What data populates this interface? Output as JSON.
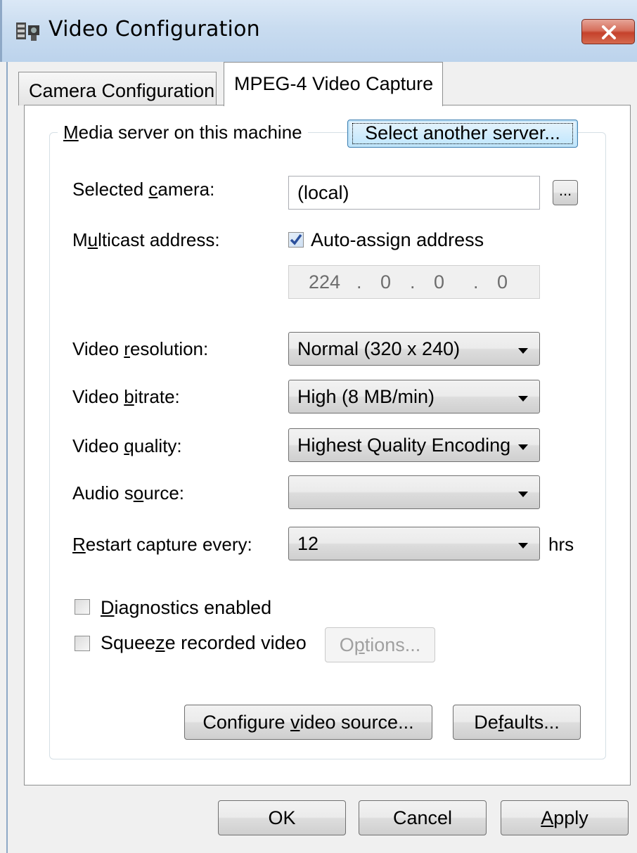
{
  "window": {
    "title": "Video Configuration"
  },
  "tabs": [
    {
      "label": "Camera Configuration",
      "active": false
    },
    {
      "label": "MPEG-4 Video Capture",
      "active": true
    }
  ],
  "group": {
    "label_pre": "",
    "label_key": "M",
    "label_post": "edia server on this machine",
    "select_server_button": "Select another server..."
  },
  "fields": {
    "selected_camera": {
      "label_pre": "Selected ",
      "label_key": "c",
      "label_post": "amera:",
      "value": "(local)",
      "browse_button": "..."
    },
    "multicast": {
      "label_pre": "M",
      "label_key": "u",
      "label_post": "lticast address:",
      "auto_assign_label": "Auto-assign address",
      "auto_assign_checked": true,
      "ip": [
        "224",
        "0",
        "0",
        "0"
      ],
      "ip_sep": "."
    },
    "video_resolution": {
      "label_pre": "Video ",
      "label_key": "r",
      "label_post": "esolution:",
      "value": "Normal  (320 x 240)"
    },
    "video_bitrate": {
      "label_pre": "Video ",
      "label_key": "b",
      "label_post": "itrate:",
      "value": "High  (8 MB/min)"
    },
    "video_quality": {
      "label_pre": "Video ",
      "label_key": "q",
      "label_post": "uality:",
      "value": "Highest Quality Encoding"
    },
    "audio_source": {
      "label_pre": "Audio s",
      "label_key": "o",
      "label_post": "urce:",
      "value": ""
    },
    "restart_capture": {
      "label_pre": "",
      "label_key": "R",
      "label_post": "estart capture every:",
      "value": "12",
      "unit": "hrs"
    }
  },
  "options": {
    "diagnostics": {
      "label_pre": "",
      "label_key": "D",
      "label_post": "iagnostics enabled",
      "checked": false
    },
    "squeeze": {
      "label_pre": "Squee",
      "label_key": "z",
      "label_post": "e recorded video",
      "checked": false
    },
    "options_button": {
      "pre": "O",
      "key": "p",
      "post": "tions..."
    }
  },
  "buttons": {
    "configure_video_source": {
      "pre": "Configure ",
      "key": "v",
      "post": "ideo source..."
    },
    "defaults": {
      "pre": "De",
      "key": "f",
      "post": "aults..."
    },
    "ok": "OK",
    "cancel": "Cancel",
    "apply": {
      "pre": "",
      "key": "A",
      "post": "pply"
    }
  },
  "colors": {
    "close_button": "#c5412b",
    "checkbox_check": "#2a4f9c",
    "title_gradient": "#c9dcf0"
  }
}
